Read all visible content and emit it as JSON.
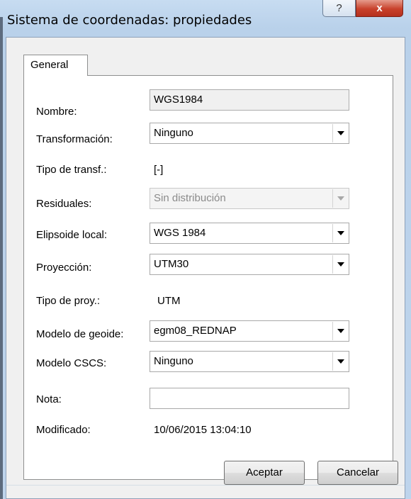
{
  "window": {
    "title": "Sistema de coordenadas: propiedades",
    "help_glyph": "?",
    "close_glyph": "x"
  },
  "tabs": [
    {
      "label": "General"
    }
  ],
  "form": {
    "nombre": {
      "label": "Nombre:",
      "value": "WGS1984"
    },
    "transformacion": {
      "label": "Transformación:",
      "value": "Ninguno"
    },
    "tipo_transf": {
      "label": "Tipo de transf.:",
      "value": "[-]"
    },
    "residuales": {
      "label": "Residuales:",
      "value": "Sin distribución"
    },
    "elipsoide": {
      "label": "Elipsoide local:",
      "value": "WGS 1984"
    },
    "proyeccion": {
      "label": "Proyección:",
      "value": "UTM30"
    },
    "tipo_proy": {
      "label": "Tipo de proy.:",
      "value": "UTM"
    },
    "geoide": {
      "label": "Modelo de geoide:",
      "value": "egm08_REDNAP"
    },
    "cscs": {
      "label": "Modelo CSCS:",
      "value": "Ninguno"
    },
    "nota": {
      "label": "Nota:",
      "value": ""
    },
    "modificado": {
      "label": "Modificado:",
      "value": "10/06/2015 13:04:10"
    }
  },
  "buttons": {
    "ok": "Aceptar",
    "cancel": "Cancelar"
  }
}
